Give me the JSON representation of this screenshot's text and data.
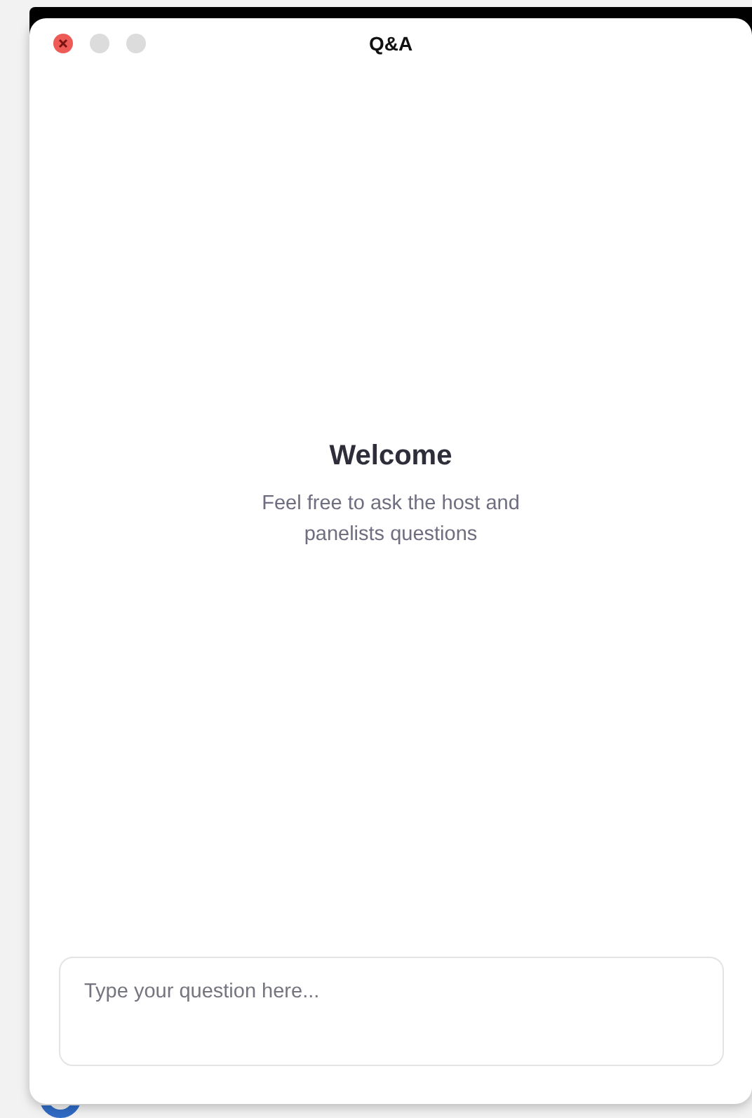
{
  "window": {
    "title": "Q&A"
  },
  "welcome": {
    "heading": "Welcome",
    "message": "Feel free to ask the host and panelists questions"
  },
  "question_field": {
    "placeholder": "Type your question here..."
  }
}
